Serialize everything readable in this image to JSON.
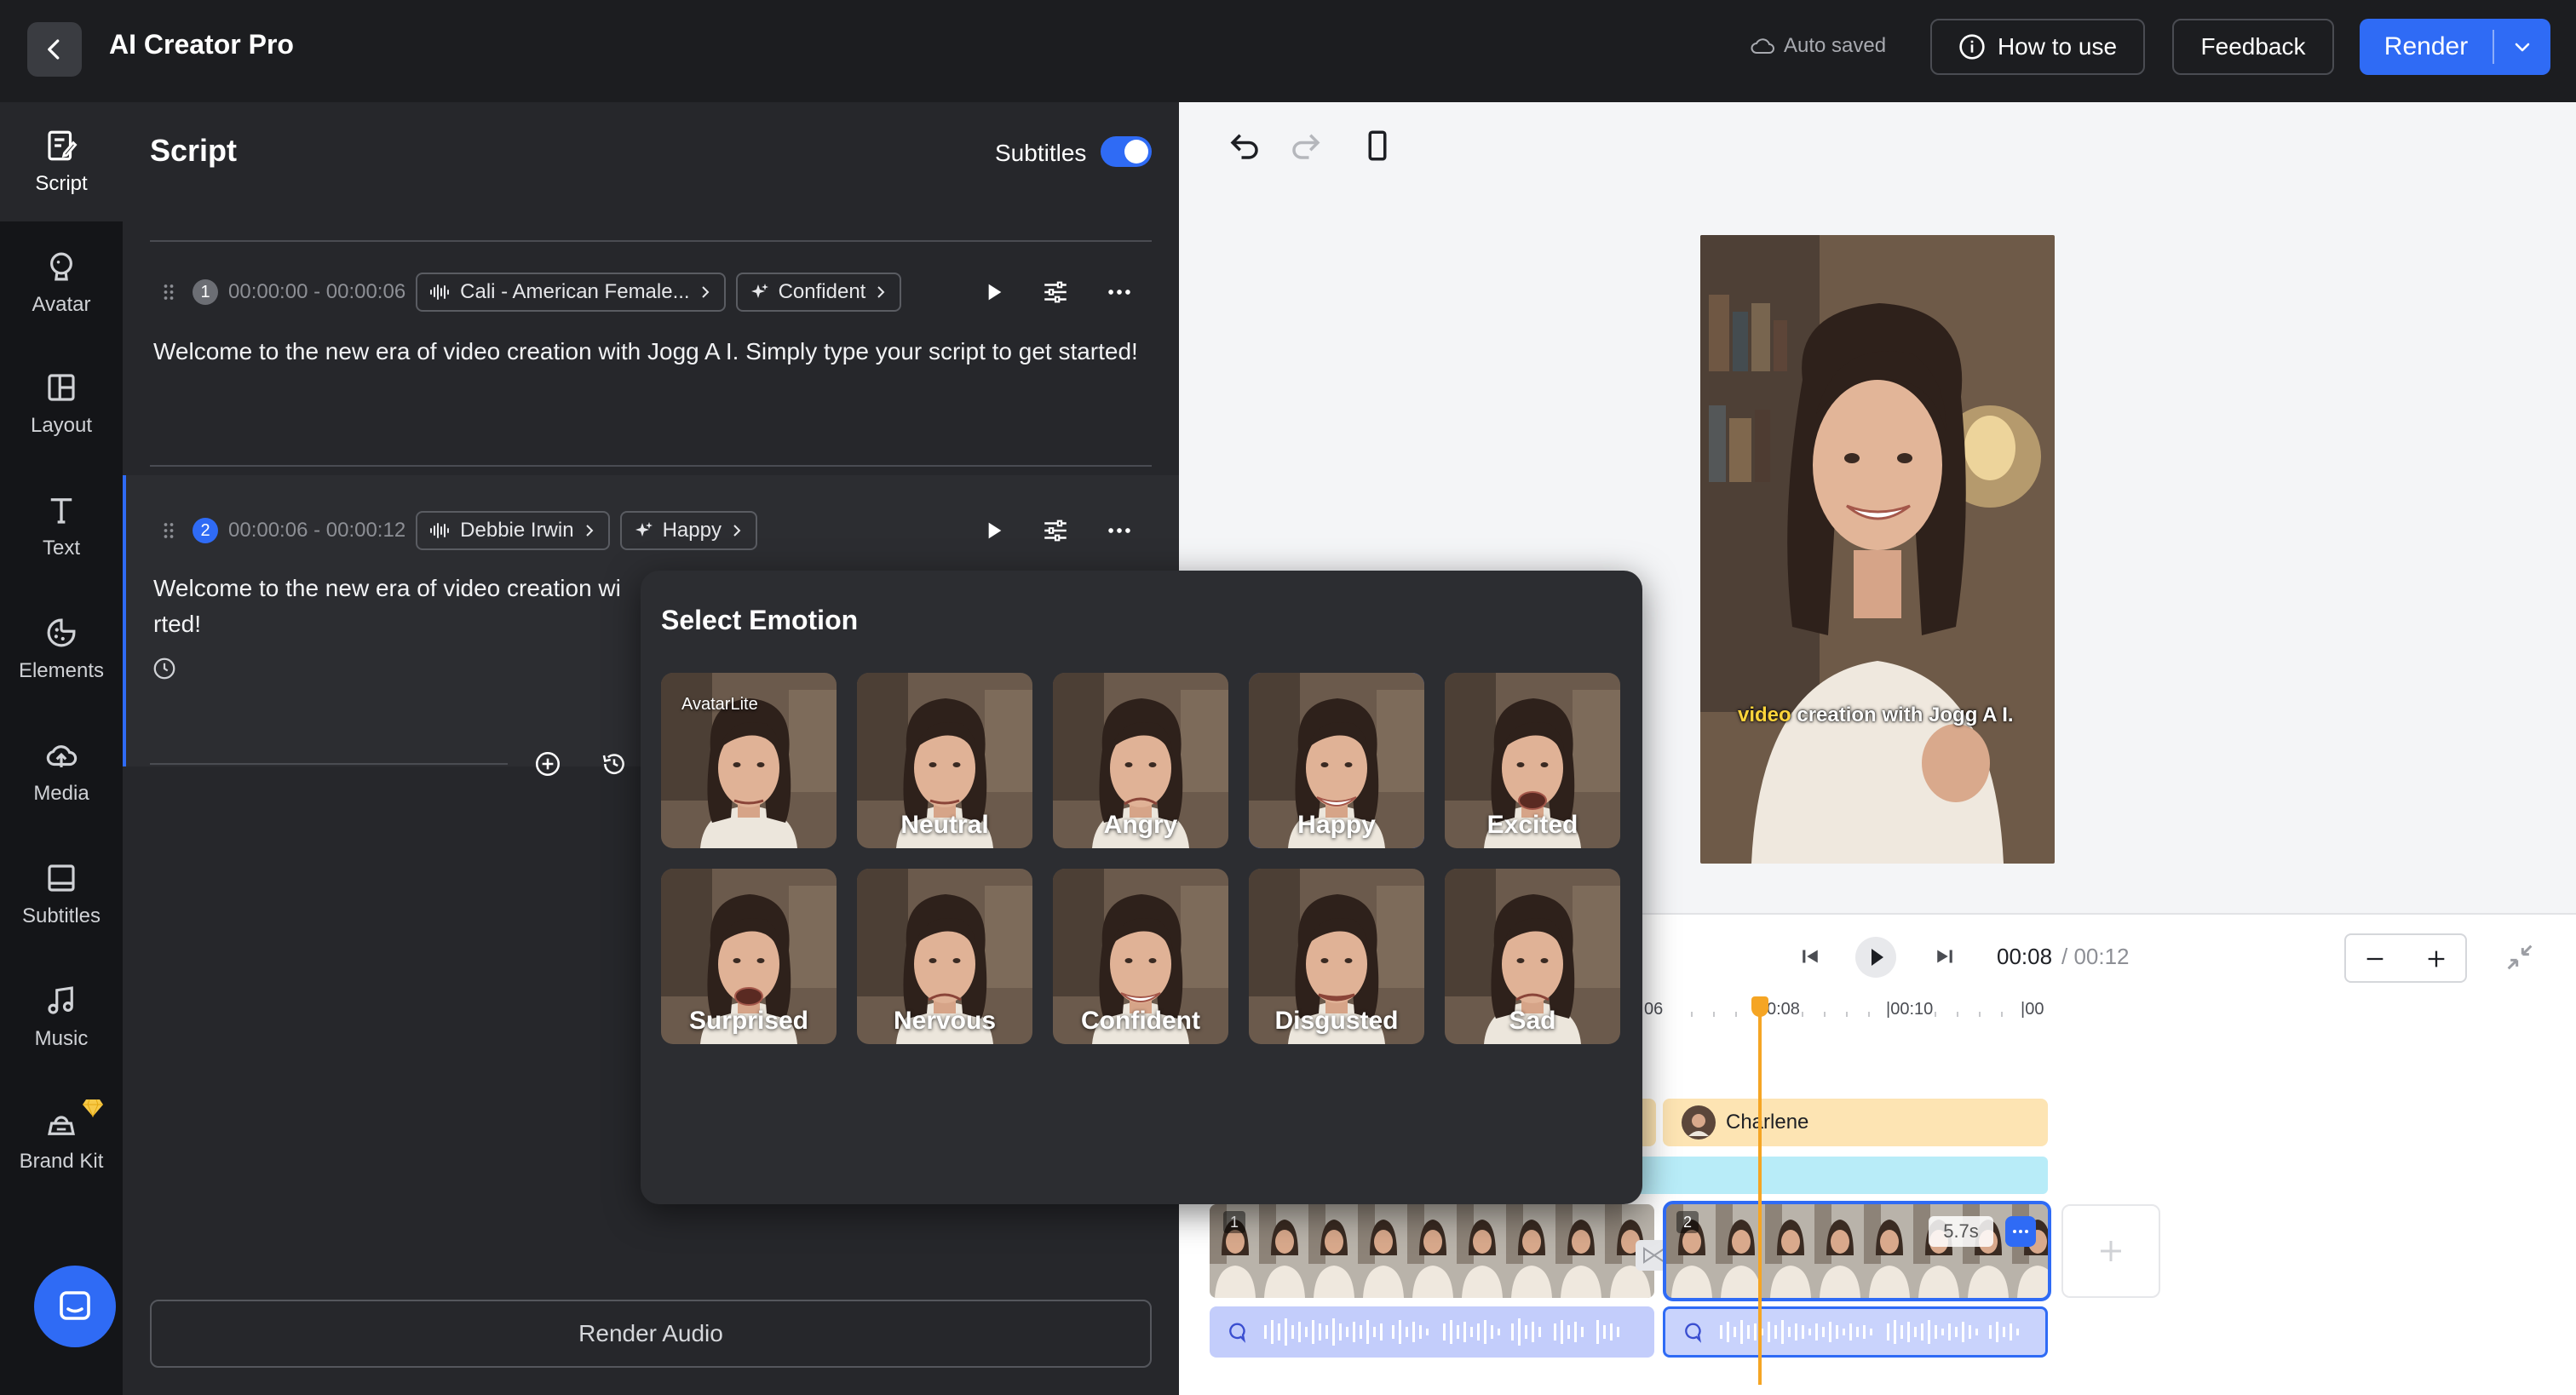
{
  "header": {
    "app_title": "AI Creator Pro",
    "auto_saved": "Auto saved",
    "how_to_use": "How to use",
    "feedback": "Feedback",
    "render": "Render"
  },
  "sidebar": {
    "items": [
      {
        "label": "Script",
        "icon": "script-icon"
      },
      {
        "label": "Avatar",
        "icon": "avatar-icon"
      },
      {
        "label": "Layout",
        "icon": "layout-icon"
      },
      {
        "label": "Text",
        "icon": "text-icon"
      },
      {
        "label": "Elements",
        "icon": "elements-icon"
      },
      {
        "label": "Media",
        "icon": "media-icon"
      },
      {
        "label": "Subtitles",
        "icon": "subtitles-icon"
      },
      {
        "label": "Music",
        "icon": "music-icon"
      },
      {
        "label": "Brand Kit",
        "icon": "brand-kit-icon"
      }
    ]
  },
  "script": {
    "title": "Script",
    "subtitles_label": "Subtitles",
    "subtitles_on": true,
    "segments": [
      {
        "num": "1",
        "time": "00:00:00 - 00:00:06",
        "voice": "Cali - American Female...",
        "emotion": "Confident",
        "text": "Welcome to the new era of video creation with Jogg A I. Simply type your script to get started!"
      },
      {
        "num": "2",
        "time": "00:00:06 - 00:00:12",
        "voice": "Debbie Irwin",
        "emotion": "Happy",
        "text": "Welcome to the new era of video creation wi",
        "text2": "rted!"
      }
    ],
    "render_audio": "Render Audio"
  },
  "emotion_picker": {
    "title": "Select Emotion",
    "selected": "Happy",
    "options": [
      {
        "label": "",
        "badge": "AvatarLite"
      },
      {
        "label": "Neutral"
      },
      {
        "label": "Angry"
      },
      {
        "label": "Happy"
      },
      {
        "label": "Excited"
      },
      {
        "label": "Surprised"
      },
      {
        "label": "Nervous"
      },
      {
        "label": "Confident"
      },
      {
        "label": "Disgusted"
      },
      {
        "label": "Sad"
      }
    ]
  },
  "preview": {
    "caption_highlight": "video",
    "caption_rest": " creation with Jogg A I."
  },
  "timeline": {
    "current_time": "00:08",
    "total_time": "/ 00:12",
    "ruler": [
      "06",
      "0:08",
      "|00:10",
      "|00"
    ],
    "avatar_track_name": "Charlene",
    "clips": [
      {
        "num": "1"
      },
      {
        "num": "2",
        "duration": "5.7s"
      }
    ]
  },
  "colors": {
    "accent": "#2f6bf5",
    "playhead": "#f5a524",
    "avatar_track": "#fde4b3",
    "subtitle_track": "#b8ecf8"
  }
}
